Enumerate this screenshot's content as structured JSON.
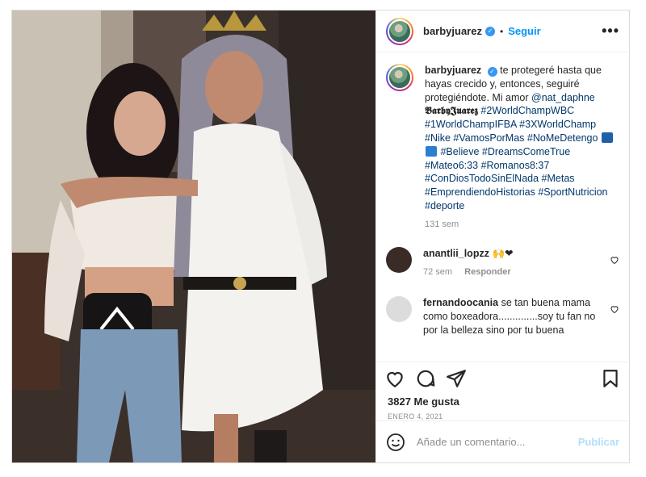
{
  "post": {
    "username": "barbyjuarez",
    "follow_label": "Seguir",
    "more_label": "•••",
    "caption": {
      "username": "barbyjuarez",
      "text_1": "te protegeré hasta que hayas crecido y, entonces, seguiré protegiéndote. Mi amor",
      "mention": "@nat_daphne",
      "styled_name": "𝕭𝖆𝖗𝖇𝖞𝕵𝖚𝖆𝖗𝖊𝖟",
      "tags_1": "#2WorldChampWBC #1WorldChampIFBA #3XWorldChamp #Nike #VamosPorMas #NoMeDetengo",
      "tags_2": "#Believe #DreamsComeTrue #Mateo6:33 #Romanos8:37 #ConDiosTodoSinElNada #Metas #EmprendiendoHistorias #SportNutricion #deporte",
      "time": "131 sem"
    },
    "comments": [
      {
        "username": "anantlii_lopzz",
        "text": "",
        "time": "72 sem",
        "reply": "Responder",
        "avatar_color": "#3a2b27"
      },
      {
        "username": "fernandoocania",
        "text": "se tan buena mama como boxeadora..............soy tu fan no por la belleza sino por tu buena",
        "avatar_color": "#dcdcdc"
      }
    ],
    "likes": "3827 Me gusta",
    "date": "ENERO 4, 2021",
    "add_comment_placeholder": "Añade un comentario...",
    "publish_label": "Publicar"
  },
  "colors": {
    "link_blue": "#0095f6",
    "hashtag": "#00376b",
    "muted": "#8e8e8e",
    "publish_disabled": "#b2dffc"
  },
  "icons": [
    "more-icon",
    "verified-icon",
    "heart-icon",
    "comment-icon",
    "share-icon",
    "save-icon",
    "emoji-icon"
  ]
}
